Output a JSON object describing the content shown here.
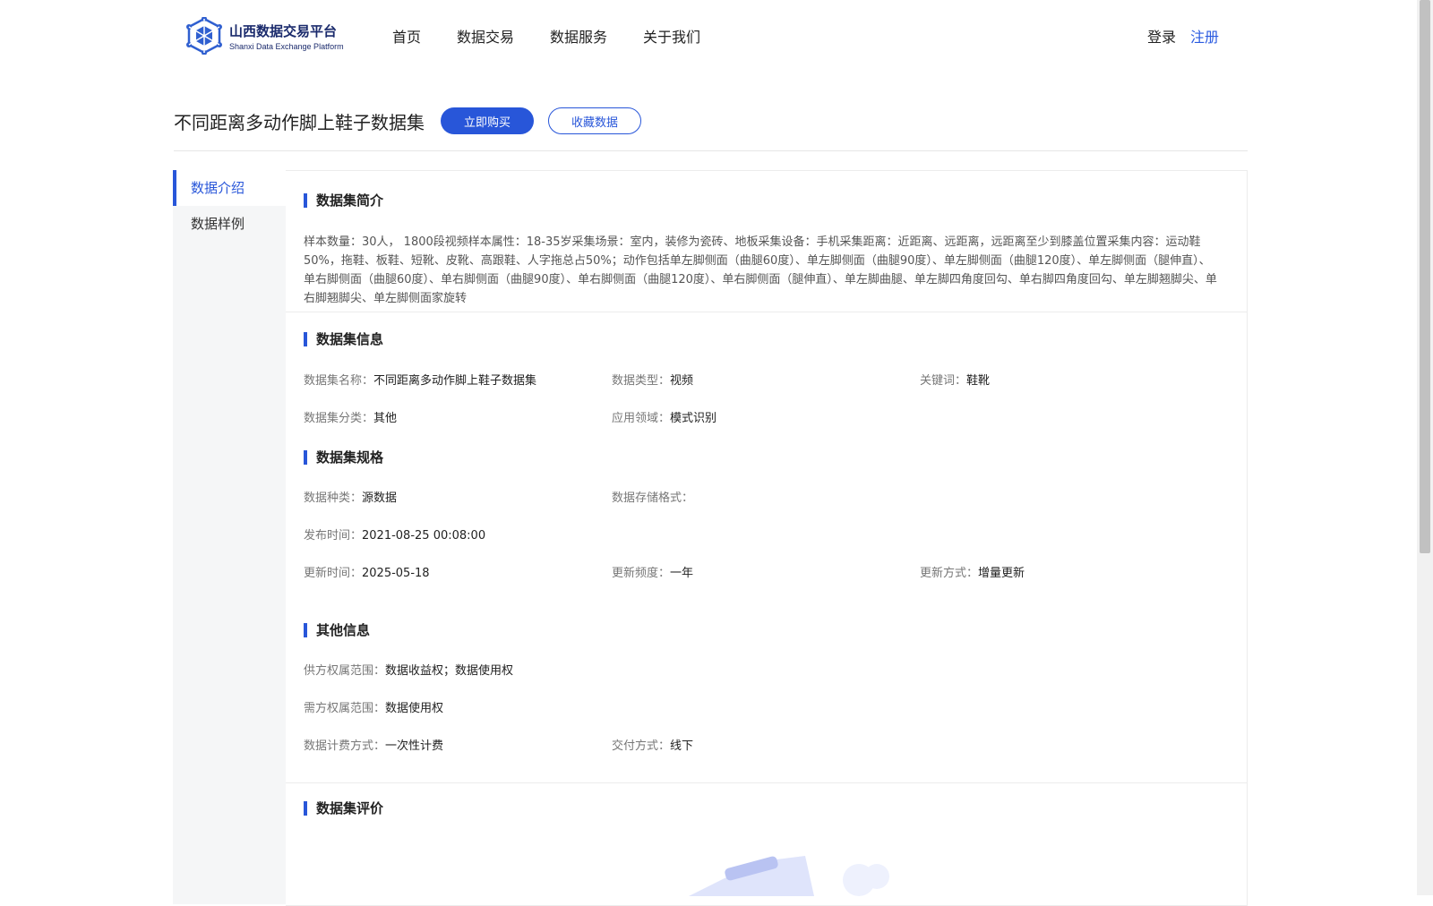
{
  "header": {
    "logo_cn": "山西数据交易平台",
    "logo_en": "Shanxi Data Exchange Platform",
    "nav": [
      "首页",
      "数据交易",
      "数据服务",
      "关于我们"
    ],
    "login": "登录",
    "register": "注册"
  },
  "title": {
    "text": "不同距离多动作脚上鞋子数据集",
    "buy": "立即购买",
    "favorite": "收藏数据"
  },
  "sidebar": {
    "items": [
      "数据介绍",
      "数据样例"
    ],
    "active_index": 0
  },
  "sections": {
    "intro": {
      "title": "数据集简介",
      "text": "样本数量：30人， 1800段视频样本属性：18-35岁采集场景：室内，装修为瓷砖、地板采集设备：手机采集距离：近距离、远距离，远距离至少到膝盖位置采集内容：运动鞋50%，拖鞋、板鞋、短靴、皮靴、高跟鞋、人字拖总占50%；动作包括单左脚侧面（曲腿60度）、单左脚侧面（曲腿90度）、单左脚侧面（曲腿120度）、单左脚侧面（腿伸直）、单右脚侧面（曲腿60度）、单右脚侧面（曲腿90度）、单右脚侧面（曲腿120度）、单右脚侧面（腿伸直）、单左脚曲腿、单左脚四角度回勾、单右脚四角度回勾、单左脚翘脚尖、单右脚翘脚尖、单左脚侧面家旋转"
    },
    "info": {
      "title": "数据集信息",
      "name_label": "数据集名称：",
      "name_value": "不同距离多动作脚上鞋子数据集",
      "type_label": "数据类型：",
      "type_value": "视频",
      "keyword_label": "关键词：",
      "keyword_value": "鞋靴",
      "category_label": "数据集分类：",
      "category_value": "其他",
      "domain_label": "应用领域：",
      "domain_value": "模式识别"
    },
    "spec": {
      "title": "数据集规格",
      "kind_label": "数据种类：",
      "kind_value": "源数据",
      "format_label": "数据存储格式：",
      "format_value": "",
      "publish_label": "发布时间：",
      "publish_value": "2021-08-25 00:08:00",
      "update_label": "更新时间：",
      "update_value": "2025-05-18",
      "freq_label": "更新频度：",
      "freq_value": "一年",
      "method_label": "更新方式：",
      "method_value": "增量更新"
    },
    "other": {
      "title": "其他信息",
      "supply_label": "供方权属范围：",
      "supply_value": "数据收益权；数据使用权",
      "demand_label": "需方权属范围：",
      "demand_value": "数据使用权",
      "billing_label": "数据计费方式：",
      "billing_value": "一次性计费",
      "delivery_label": "交付方式：",
      "delivery_value": "线下"
    },
    "review": {
      "title": "数据集评价"
    }
  },
  "colors": {
    "accent": "#2856d9",
    "sidebar_bg": "#f5f6f7"
  }
}
